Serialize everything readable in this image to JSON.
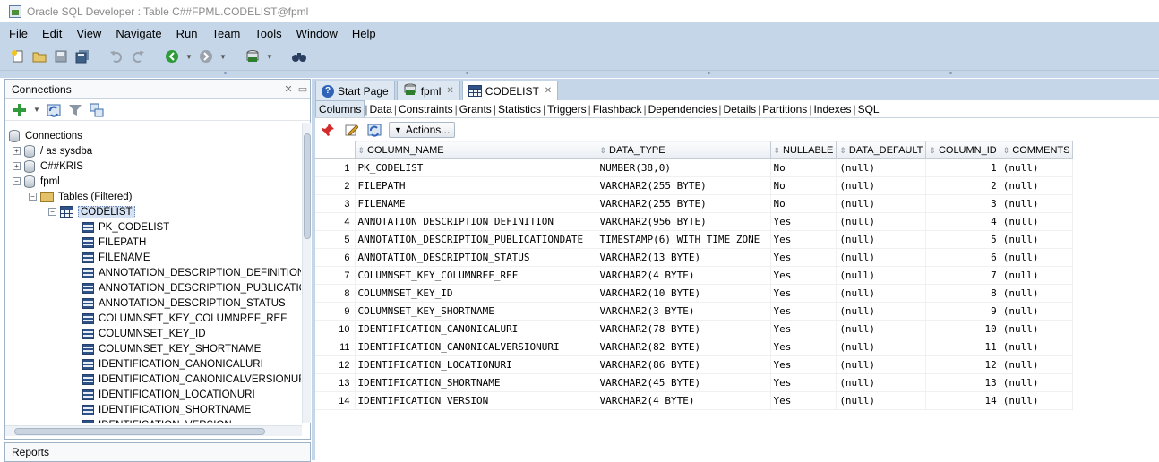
{
  "window": {
    "title": "Oracle SQL Developer : Table C##FPML.CODELIST@fpml"
  },
  "menu": [
    {
      "mn": "F",
      "rest": "ile"
    },
    {
      "mn": "E",
      "rest": "dit"
    },
    {
      "mn": "V",
      "rest": "iew"
    },
    {
      "mn": "N",
      "rest": "avigate"
    },
    {
      "mn": "R",
      "rest": "un"
    },
    {
      "mn": "T",
      "rest": "eam"
    },
    {
      "mn": "T",
      "rest": "ools"
    },
    {
      "mn": "W",
      "rest": "indow"
    },
    {
      "mn": "H",
      "rest": "elp"
    }
  ],
  "toolbar": {
    "icons": [
      "new-file-icon",
      "open-folder-icon",
      "save-icon",
      "save-all-icon",
      "undo-icon",
      "redo-icon",
      "back-icon",
      "forward-icon",
      "sql-worksheet-icon",
      "binoculars-icon"
    ]
  },
  "connections_panel": {
    "title": "Connections",
    "tree": [
      {
        "level": 0,
        "label": "Connections",
        "kind": "conn-root",
        "toggle": ""
      },
      {
        "level": 1,
        "label": "/ as sysdba",
        "kind": "db",
        "toggle": "+"
      },
      {
        "level": 1,
        "label": "C##KRIS",
        "kind": "db",
        "toggle": "+"
      },
      {
        "level": 1,
        "label": "fpml",
        "kind": "db-sql",
        "toggle": "−"
      },
      {
        "level": 2,
        "label": "Tables (Filtered)",
        "kind": "folder",
        "toggle": "−"
      },
      {
        "level": 3,
        "label": "CODELIST",
        "kind": "table",
        "toggle": "−",
        "selected": true
      },
      {
        "level": 4,
        "label": "PK_CODELIST",
        "kind": "col"
      },
      {
        "level": 4,
        "label": "FILEPATH",
        "kind": "col"
      },
      {
        "level": 4,
        "label": "FILENAME",
        "kind": "col"
      },
      {
        "level": 4,
        "label": "ANNOTATION_DESCRIPTION_DEFINITION",
        "kind": "col"
      },
      {
        "level": 4,
        "label": "ANNOTATION_DESCRIPTION_PUBLICATIONDATE",
        "kind": "col"
      },
      {
        "level": 4,
        "label": "ANNOTATION_DESCRIPTION_STATUS",
        "kind": "col"
      },
      {
        "level": 4,
        "label": "COLUMNSET_KEY_COLUMNREF_REF",
        "kind": "col"
      },
      {
        "level": 4,
        "label": "COLUMNSET_KEY_ID",
        "kind": "col"
      },
      {
        "level": 4,
        "label": "COLUMNSET_KEY_SHORTNAME",
        "kind": "col"
      },
      {
        "level": 4,
        "label": "IDENTIFICATION_CANONICALURI",
        "kind": "col"
      },
      {
        "level": 4,
        "label": "IDENTIFICATION_CANONICALVERSIONURI",
        "kind": "col"
      },
      {
        "level": 4,
        "label": "IDENTIFICATION_LOCATIONURI",
        "kind": "col"
      },
      {
        "level": 4,
        "label": "IDENTIFICATION_SHORTNAME",
        "kind": "col"
      },
      {
        "level": 4,
        "label": "IDENTIFICATION_VERSION",
        "kind": "col"
      }
    ]
  },
  "reports_panel": {
    "title": "Reports"
  },
  "doc_tabs": [
    {
      "label": "Start Page",
      "icon": "help-icon",
      "active": false
    },
    {
      "label": "fpml",
      "icon": "sql-connection-icon",
      "active": false
    },
    {
      "label": "CODELIST",
      "icon": "table-icon",
      "active": true
    }
  ],
  "sub_tabs": [
    "Columns",
    "Data",
    "Constraints",
    "Grants",
    "Statistics",
    "Triggers",
    "Flashback",
    "Dependencies",
    "Details",
    "Partitions",
    "Indexes",
    "SQL"
  ],
  "active_sub_tab": "Columns",
  "grid_toolbar": {
    "actions_label": "Actions..."
  },
  "columns_grid": {
    "headers": [
      "COLUMN_NAME",
      "DATA_TYPE",
      "NULLABLE",
      "DATA_DEFAULT",
      "COLUMN_ID",
      "COMMENTS"
    ],
    "rows": [
      [
        "1",
        "PK_CODELIST",
        "NUMBER(38,0)",
        "No",
        "(null)",
        "1",
        "(null)"
      ],
      [
        "2",
        "FILEPATH",
        "VARCHAR2(255 BYTE)",
        "No",
        "(null)",
        "2",
        "(null)"
      ],
      [
        "3",
        "FILENAME",
        "VARCHAR2(255 BYTE)",
        "No",
        "(null)",
        "3",
        "(null)"
      ],
      [
        "4",
        "ANNOTATION_DESCRIPTION_DEFINITION",
        "VARCHAR2(956 BYTE)",
        "Yes",
        "(null)",
        "4",
        "(null)"
      ],
      [
        "5",
        "ANNOTATION_DESCRIPTION_PUBLICATIONDATE",
        "TIMESTAMP(6) WITH TIME ZONE",
        "Yes",
        "(null)",
        "5",
        "(null)"
      ],
      [
        "6",
        "ANNOTATION_DESCRIPTION_STATUS",
        "VARCHAR2(13 BYTE)",
        "Yes",
        "(null)",
        "6",
        "(null)"
      ],
      [
        "7",
        "COLUMNSET_KEY_COLUMNREF_REF",
        "VARCHAR2(4 BYTE)",
        "Yes",
        "(null)",
        "7",
        "(null)"
      ],
      [
        "8",
        "COLUMNSET_KEY_ID",
        "VARCHAR2(10 BYTE)",
        "Yes",
        "(null)",
        "8",
        "(null)"
      ],
      [
        "9",
        "COLUMNSET_KEY_SHORTNAME",
        "VARCHAR2(3 BYTE)",
        "Yes",
        "(null)",
        "9",
        "(null)"
      ],
      [
        "10",
        "IDENTIFICATION_CANONICALURI",
        "VARCHAR2(78 BYTE)",
        "Yes",
        "(null)",
        "10",
        "(null)"
      ],
      [
        "11",
        "IDENTIFICATION_CANONICALVERSIONURI",
        "VARCHAR2(82 BYTE)",
        "Yes",
        "(null)",
        "11",
        "(null)"
      ],
      [
        "12",
        "IDENTIFICATION_LOCATIONURI",
        "VARCHAR2(86 BYTE)",
        "Yes",
        "(null)",
        "12",
        "(null)"
      ],
      [
        "13",
        "IDENTIFICATION_SHORTNAME",
        "VARCHAR2(45 BYTE)",
        "Yes",
        "(null)",
        "13",
        "(null)"
      ],
      [
        "14",
        "IDENTIFICATION_VERSION",
        "VARCHAR2(4 BYTE)",
        "Yes",
        "(null)",
        "14",
        "(null)"
      ]
    ]
  }
}
